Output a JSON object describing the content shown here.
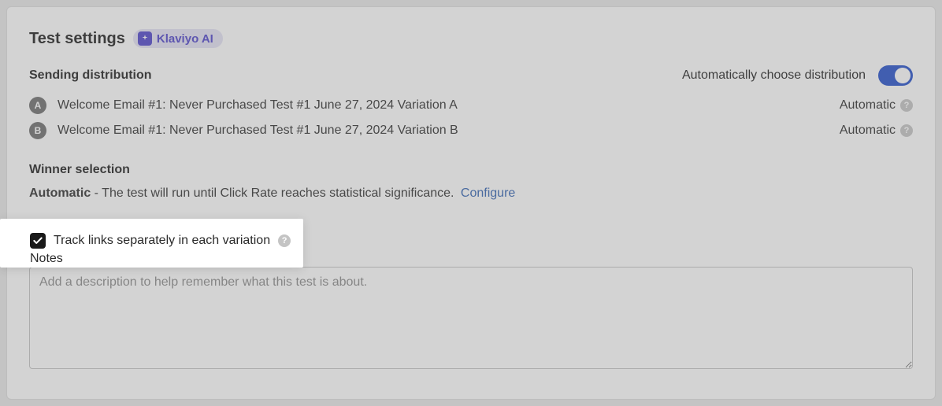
{
  "header": {
    "title": "Test settings",
    "ai_badge": "Klaviyo AI"
  },
  "sending_distribution": {
    "label": "Sending distribution",
    "auto_label": "Automatically choose distribution",
    "auto_on": true,
    "variations": [
      {
        "letter": "A",
        "name": "Welcome Email #1: Never Purchased Test #1 June 27, 2024 Variation A",
        "mode": "Automatic"
      },
      {
        "letter": "B",
        "name": "Welcome Email #1: Never Purchased Test #1 June 27, 2024 Variation B",
        "mode": "Automatic"
      }
    ]
  },
  "winner_selection": {
    "label": "Winner selection",
    "mode": "Automatic",
    "dash": " - ",
    "description": "The test will run until Click Rate reaches statistical significance.",
    "configure": "Configure"
  },
  "track_links": {
    "label": "Track links separately in each variation",
    "checked": true
  },
  "notes": {
    "label": "Notes",
    "placeholder": "Add a description to help remember what this test is about.",
    "value": ""
  }
}
